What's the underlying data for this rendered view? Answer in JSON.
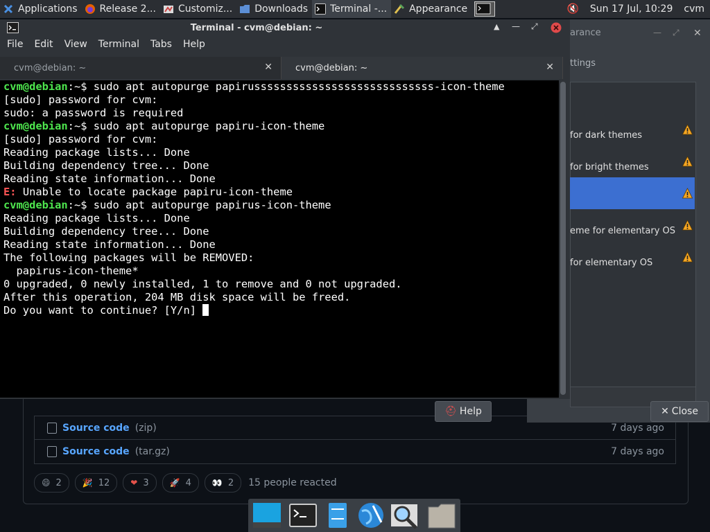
{
  "panel": {
    "items": [
      {
        "label": "Applications",
        "icon": "xfce-logo-icon"
      },
      {
        "label": "Release 2...",
        "icon": "firefox-icon"
      },
      {
        "label": "Customiz...",
        "icon": "customize-icon"
      },
      {
        "label": "Downloads",
        "icon": "folder-icon"
      },
      {
        "label": "Terminal -...",
        "icon": "terminal-icon"
      },
      {
        "label": "Appearance",
        "icon": "appearance-icon"
      }
    ],
    "clock": "Sun 17 Jul, 10:29",
    "user": "cvm"
  },
  "terminal": {
    "title": "Terminal - cvm@debian: ~",
    "menu": [
      "File",
      "Edit",
      "View",
      "Terminal",
      "Tabs",
      "Help"
    ],
    "tabs": [
      {
        "label": "cvm@debian: ~",
        "active": false
      },
      {
        "label": "cvm@debian: ~",
        "active": true
      }
    ],
    "prompt": "cvm@debian",
    "prompt_suffix": ":~$ ",
    "error_prefix": "E:",
    "lines": [
      {
        "type": "cmd",
        "text": "sudo apt autopurge papirussssssssssssssssssssssssssss-icon-theme"
      },
      {
        "type": "out",
        "text": "[sudo] password for cvm:"
      },
      {
        "type": "out",
        "text": "sudo: a password is required"
      },
      {
        "type": "cmd",
        "text": "sudo apt autopurge papiru-icon-theme"
      },
      {
        "type": "out",
        "text": "[sudo] password for cvm:"
      },
      {
        "type": "out",
        "text": "Reading package lists... Done"
      },
      {
        "type": "out",
        "text": "Building dependency tree... Done"
      },
      {
        "type": "out",
        "text": "Reading state information... Done"
      },
      {
        "type": "err",
        "text": " Unable to locate package papiru-icon-theme"
      },
      {
        "type": "cmd",
        "text": "sudo apt autopurge papirus-icon-theme"
      },
      {
        "type": "out",
        "text": "Reading package lists... Done"
      },
      {
        "type": "out",
        "text": "Building dependency tree... Done"
      },
      {
        "type": "out",
        "text": "Reading state information... Done"
      },
      {
        "type": "out",
        "text": "The following packages will be REMOVED:"
      },
      {
        "type": "out",
        "text": "  papirus-icon-theme*"
      },
      {
        "type": "out",
        "text": "0 upgraded, 0 newly installed, 1 to remove and 0 not upgraded."
      },
      {
        "type": "out",
        "text": "After this operation, 204 MB disk space will be freed."
      },
      {
        "type": "ask",
        "text": "Do you want to continue? [Y/n] "
      }
    ]
  },
  "appearance": {
    "title": "arance",
    "tab": "ttings",
    "items": [
      {
        "label": "for dark themes",
        "selected": false
      },
      {
        "label": "for bright themes",
        "selected": false
      },
      {
        "label": "",
        "selected": true
      },
      {
        "label": "eme for elementary OS",
        "selected": false
      },
      {
        "label": "for elementary OS",
        "selected": false
      }
    ],
    "help_label": "Help",
    "close_label": "Close"
  },
  "github": {
    "assets": [
      {
        "name": "Source code",
        "ext": "(zip)",
        "age": "7 days ago"
      },
      {
        "name": "Source code",
        "ext": "(tar.gz)",
        "age": "7 days ago"
      }
    ],
    "reactions": [
      {
        "emoji": "😄",
        "count": "2"
      },
      {
        "emoji": "🎉",
        "count": "12"
      },
      {
        "emoji": "❤",
        "count": "3"
      },
      {
        "emoji": "🚀",
        "count": "4"
      },
      {
        "emoji": "👀",
        "count": "2"
      }
    ],
    "reacted_text": "15 people reacted"
  },
  "dock": {
    "items": [
      "show-desktop-icon",
      "terminal-icon",
      "file-manager-icon",
      "web-browser-icon",
      "app-finder-icon",
      "home-folder-icon"
    ]
  }
}
